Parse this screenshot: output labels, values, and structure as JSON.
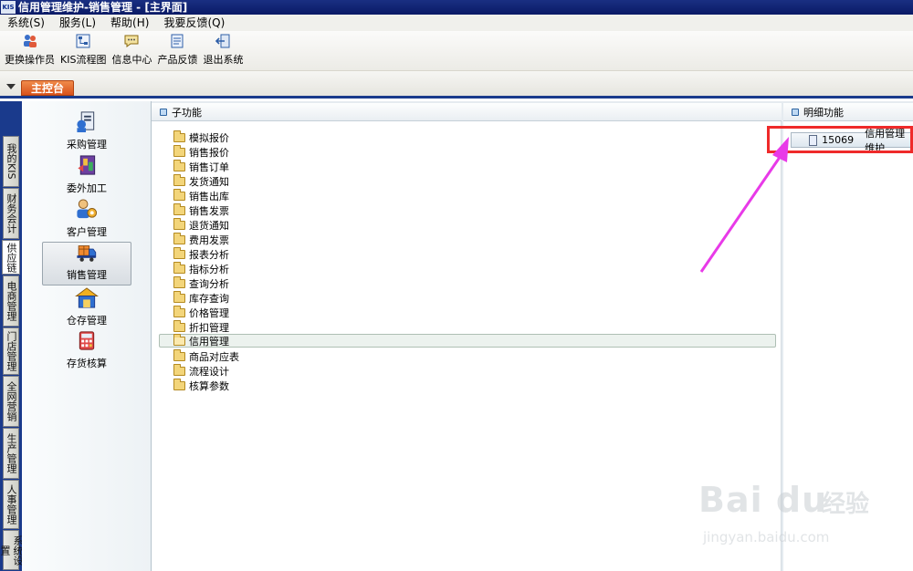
{
  "window": {
    "app_icon_text": "KIS",
    "title": "信用管理维护-销售管理 - [主界面]"
  },
  "menubar": {
    "items": [
      "系统(S)",
      "服务(L)",
      "帮助(H)",
      "我要反馈(Q)"
    ]
  },
  "toolbar": {
    "buttons": [
      {
        "label": "更换操作员",
        "icon": "switch-operator-icon"
      },
      {
        "label": "KIS流程图",
        "icon": "flowchart-icon"
      },
      {
        "label": "信息中心",
        "icon": "message-center-icon"
      },
      {
        "label": "产品反馈",
        "icon": "feedback-icon"
      },
      {
        "label": "退出系统",
        "icon": "exit-icon"
      }
    ]
  },
  "console_tab": {
    "label": "主控台"
  },
  "side_tabs": {
    "items": [
      "我的KIS",
      "财务会计",
      "供应链",
      "电商管理",
      "门店管理",
      "全网营销",
      "生产管理",
      "人事管理",
      "系统设置"
    ],
    "active_index": 2
  },
  "modules": {
    "items": [
      {
        "label": "采购管理",
        "icon": "purchase-icon"
      },
      {
        "label": "委外加工",
        "icon": "outsourcing-icon"
      },
      {
        "label": "客户管理",
        "icon": "customer-icon"
      },
      {
        "label": "销售管理",
        "icon": "sales-truck-icon"
      },
      {
        "label": "仓存管理",
        "icon": "warehouse-icon"
      },
      {
        "label": "存货核算",
        "icon": "inventory-accounting-icon"
      }
    ],
    "selected_index": 3
  },
  "sub_functions": {
    "header": "子功能",
    "items": [
      "模拟报价",
      "销售报价",
      "销售订单",
      "发货通知",
      "销售出库",
      "销售发票",
      "退货通知",
      "费用发票",
      "报表分析",
      "指标分析",
      "查询分析",
      "库存查询",
      "价格管理",
      "折扣管理",
      "信用管理",
      "商品对应表",
      "流程设计",
      "核算参数"
    ],
    "selected_index": 14
  },
  "detail_functions": {
    "header": "明细功能",
    "items": [
      {
        "code": "15069",
        "label": "信用管理维护"
      }
    ]
  },
  "watermark": {
    "logo": "Bai du",
    "cn": "经验",
    "url": "jingyan.baidu.com"
  },
  "colors": {
    "title_bar": "#0a1a66",
    "frame_blue": "#1a3a8c",
    "console_tab": "#d9531c",
    "annotation_red": "#ef2a2a",
    "annotation_arrow": "#e83ae8"
  }
}
